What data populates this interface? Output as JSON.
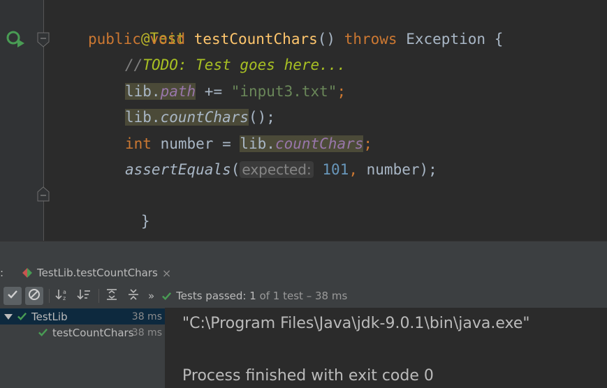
{
  "editor": {
    "annotation": "@Test",
    "signature": {
      "kw_public": "public",
      "kw_void": "void",
      "method": "testCountChars",
      "parens": "()",
      "kw_throws": "throws",
      "exception": "Exception",
      "brace": "{"
    },
    "todo_comment_slashes": "//",
    "todo_comment": "TODO: Test goes here...",
    "line_path": {
      "obj": "lib.",
      "field": "path",
      "op": " += ",
      "str": "\"input3.txt\"",
      "semi": ";"
    },
    "line_count": {
      "obj": "lib.",
      "method": "countChars",
      "rest": "();"
    },
    "line_number": {
      "kw_int": "int",
      "var": " number = ",
      "obj": "lib.",
      "field": "countChars",
      "semi": ";"
    },
    "line_assert": {
      "method": "assertEquals",
      "open": "(",
      "hint": "expected:",
      "num": "101",
      "comma": ",",
      "arg": " number",
      "close": ");"
    },
    "closing_brace": "}"
  },
  "run_panel": {
    "tab_label": "TestLib.testCountChars",
    "tab_close": "×",
    "left_edge_label": ":",
    "status": {
      "prefix": "Tests passed:",
      "count": "1",
      "suffix": "of 1 test",
      "duration": "– 38 ms"
    },
    "more_label": "»",
    "tree": [
      {
        "label": "TestLib",
        "time": "38 ms"
      },
      {
        "label": "testCountChars",
        "time": "38 ms"
      }
    ],
    "console": [
      "\"C:\\Program Files\\Java\\jdk-9.0.1\\bin\\java.exe\"",
      "",
      "Process finished with exit code 0"
    ]
  },
  "colors": {
    "editor_bg": "#2b2b2b",
    "keyword": "#cc7832",
    "annotation": "#bbb529",
    "method": "#ffc66d",
    "field": "#9876aa",
    "string": "#6a8759",
    "number": "#6897bb",
    "todo": "#a8c023",
    "passed": "#499c54"
  }
}
